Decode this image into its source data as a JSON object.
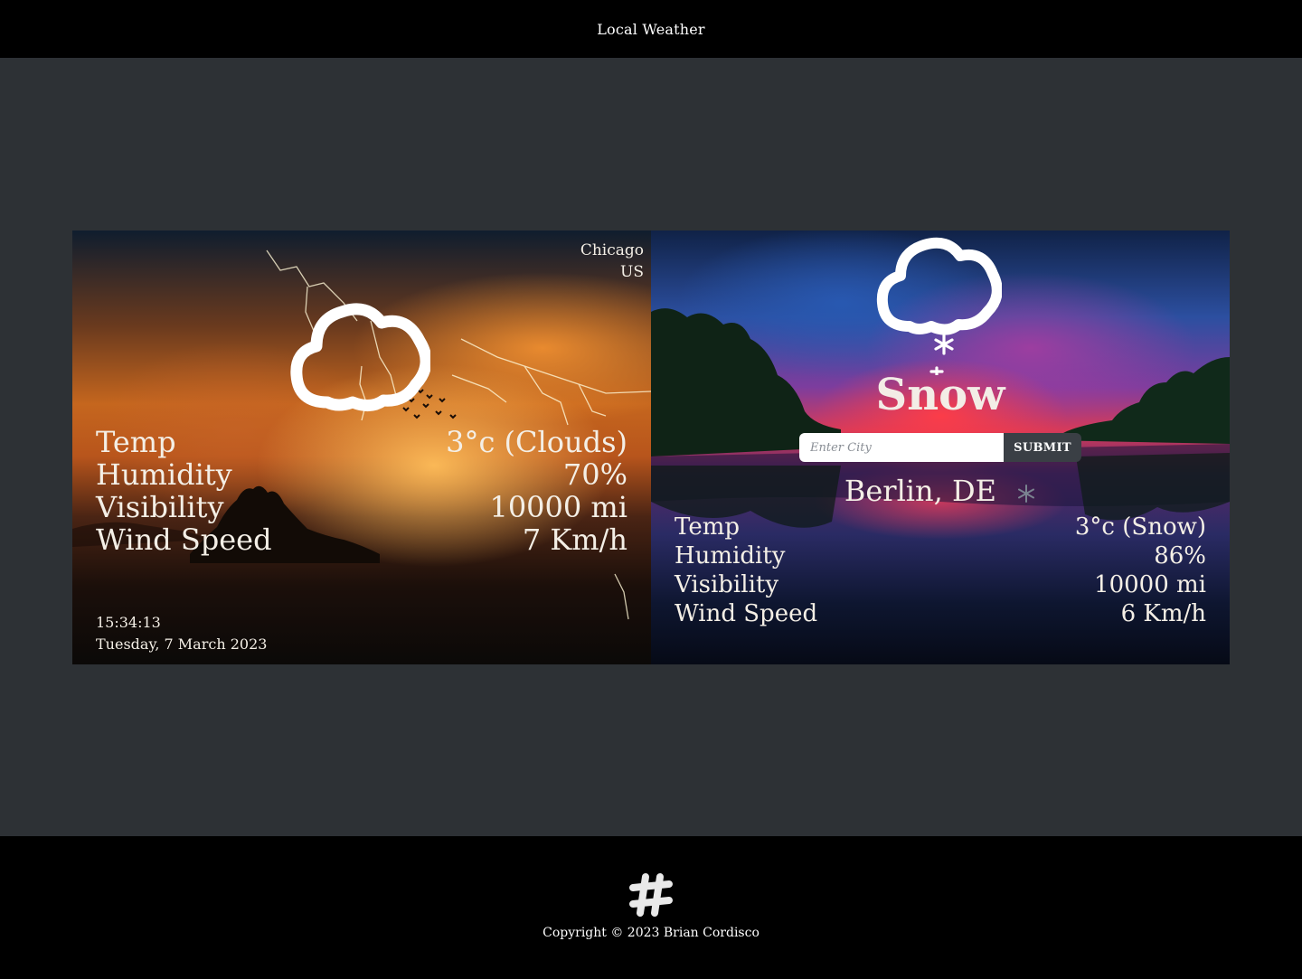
{
  "header": {
    "title": "Local Weather"
  },
  "left_card": {
    "city": "Chicago",
    "country": "US",
    "icon": "cloud-icon",
    "rows": [
      {
        "label": "Temp",
        "value": "3°c (Clouds)"
      },
      {
        "label": "Humidity",
        "value": "70%"
      },
      {
        "label": "Visibility",
        "value": "10000 mi"
      },
      {
        "label": "Wind Speed",
        "value": "7 Km/h"
      }
    ],
    "time": "15:34:13",
    "date": "Tuesday, 7 March 2023"
  },
  "right_card": {
    "icon": "snow-cloud-icon",
    "condition": "Snow",
    "search": {
      "placeholder": "Enter City",
      "value": "",
      "button": "SUBMIT"
    },
    "location": "Berlin, DE",
    "rows": [
      {
        "label": "Temp",
        "value": "3°c (Snow)"
      },
      {
        "label": "Humidity",
        "value": "86%"
      },
      {
        "label": "Visibility",
        "value": "10000 mi"
      },
      {
        "label": "Wind Speed",
        "value": "6 Km/h"
      }
    ]
  },
  "footer": {
    "logo_icon": "hashtag-logo-icon",
    "copyright": "Copyright © 2023 Brian Cordisco"
  }
}
